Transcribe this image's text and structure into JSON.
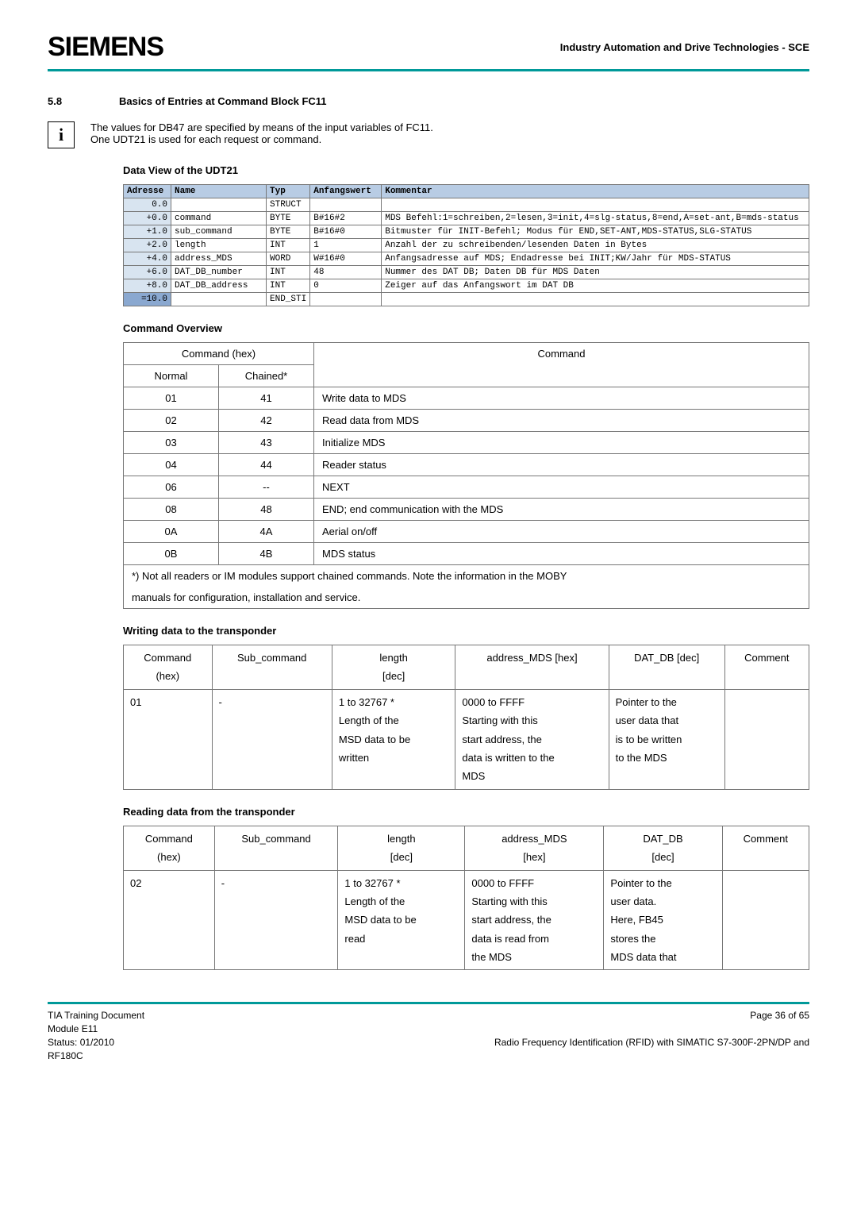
{
  "header": {
    "brand": "SIEMENS",
    "right": "Industry Automation and Drive Technologies - SCE"
  },
  "section": {
    "num": "5.8",
    "title": "Basics of Entries at Command Block FC11"
  },
  "info": {
    "icon": "i",
    "line1": "The values for DB47 are specified by means of the input variables of FC11.",
    "line2": "One UDT21 is used for each request or command."
  },
  "dv": {
    "heading": "Data View of the UDT21",
    "cols": {
      "addr": "Adresse",
      "name": "Name",
      "typ": "Typ",
      "anf": "Anfangswert",
      "kom": "Kommentar"
    },
    "rows": [
      {
        "addr": "0.0",
        "name": "",
        "typ": "STRUCT",
        "anf": "",
        "kom": ""
      },
      {
        "addr": "+0.0",
        "name": "command",
        "typ": "BYTE",
        "anf": "B#16#2",
        "kom": "MDS Befehl:1=schreiben,2=lesen,3=init,4=slg-status,8=end,A=set-ant,B=mds-status"
      },
      {
        "addr": "+1.0",
        "name": "sub_command",
        "typ": "BYTE",
        "anf": "B#16#0",
        "kom": "Bitmuster für INIT-Befehl; Modus für END,SET-ANT,MDS-STATUS,SLG-STATUS"
      },
      {
        "addr": "+2.0",
        "name": "length",
        "typ": "INT",
        "anf": "1",
        "kom": "Anzahl der zu schreibenden/lesenden Daten in Bytes"
      },
      {
        "addr": "+4.0",
        "name": "address_MDS",
        "typ": "WORD",
        "anf": "W#16#0",
        "kom": "Anfangsadresse auf MDS; Endadresse bei INIT;KW/Jahr für MDS-STATUS"
      },
      {
        "addr": "+6.0",
        "name": "DAT_DB_number",
        "typ": "INT",
        "anf": "48",
        "kom": "Nummer des DAT DB; Daten DB für MDS Daten"
      },
      {
        "addr": "+8.0",
        "name": "DAT_DB_address",
        "typ": "INT",
        "anf": "0",
        "kom": "Zeiger auf das Anfangswort im DAT DB"
      },
      {
        "addr": "=10.0",
        "name": "",
        "typ": "END_STI",
        "anf": "",
        "kom": ""
      }
    ]
  },
  "cmd": {
    "heading": "Command Overview",
    "head_left": "Command (hex)",
    "head_right": "Command",
    "sub_normal": "Normal",
    "sub_chained": "Chained*",
    "rows": [
      {
        "n": "01",
        "c": "41",
        "d": "Write data to MDS"
      },
      {
        "n": "02",
        "c": "42",
        "d": "Read data from MDS"
      },
      {
        "n": "03",
        "c": "43",
        "d": "Initialize MDS"
      },
      {
        "n": "04",
        "c": "44",
        "d": "Reader status"
      },
      {
        "n": "06",
        "c": "--",
        "d": "NEXT"
      },
      {
        "n": "08",
        "c": "48",
        "d": "END; end communication with the MDS"
      },
      {
        "n": "0A",
        "c": "4A",
        "d": "Aerial on/off"
      },
      {
        "n": "0B",
        "c": "4B",
        "d": "MDS status"
      }
    ],
    "note1": "*)  Not all readers or IM modules support chained commands. Note the information in the MOBY",
    "note2": "manuals for configuration, installation and service."
  },
  "write": {
    "heading": "Writing data to the transponder",
    "cols": {
      "c1a": "Command",
      "c1b": "(hex)",
      "c2": "Sub_command",
      "c3a": "length",
      "c3b": "[dec]",
      "c4": "address_MDS [hex]",
      "c5": "DAT_DB [dec]",
      "c6": "Comment"
    },
    "row": {
      "cmd": "01",
      "sub": "-",
      "len": "1 to 32767 *\nLength of the\nMSD data to be\nwritten",
      "addr": "0000 to FFFF\nStarting with this\nstart address, the\ndata is written to the\nMDS",
      "dat": "Pointer to the\nuser data that\nis to be written\nto the MDS",
      "comment": ""
    }
  },
  "read": {
    "heading": "Reading data from the transponder",
    "cols": {
      "c1a": "Command",
      "c1b": "(hex)",
      "c2": "Sub_command",
      "c3a": "length",
      "c3b": "[dec]",
      "c4a": "address_MDS",
      "c4b": "[hex]",
      "c5a": "DAT_DB",
      "c5b": "[dec]",
      "c6": "Comment"
    },
    "row": {
      "cmd": "02",
      "sub": "-",
      "len": "1 to 32767 *\nLength of the\nMSD data to be\nread",
      "addr": "0000 to FFFF\nStarting with this\nstart address, the\ndata is read from\nthe MDS",
      "dat": "Pointer to the\nuser data.\nHere, FB45\nstores  the\nMDS data that",
      "comment": ""
    }
  },
  "footer": {
    "l1": "TIA Training Document",
    "l2": "Module E11",
    "l3": "Status: 01/2010",
    "l4": "RF180C",
    "page": "Page 36 of 65",
    "right": "Radio Frequency Identification (RFID) with SIMATIC S7-300F-2PN/DP and"
  }
}
